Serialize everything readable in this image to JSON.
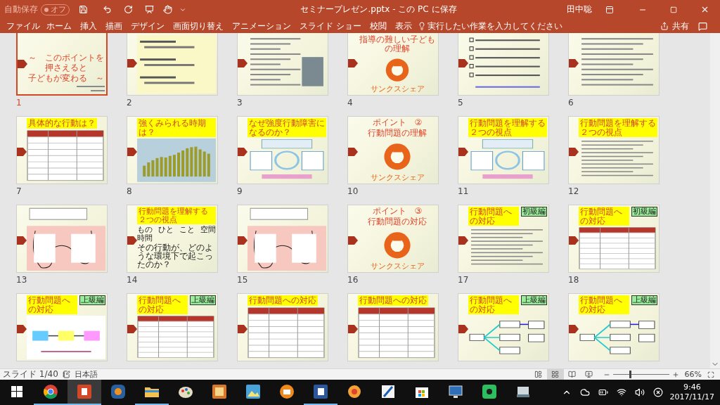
{
  "title_bar": {
    "autosave_label": "自動保存",
    "autosave_state": "オフ",
    "autosave_on": false,
    "document_title": "セミナープレゼン.pptx - この PC に保存",
    "user": "田中聡"
  },
  "ribbon": {
    "tabs": [
      {
        "label": "ファイル",
        "selected": false
      },
      {
        "label": "ホーム",
        "selected": false
      },
      {
        "label": "挿入",
        "selected": false
      },
      {
        "label": "描画",
        "selected": false
      },
      {
        "label": "デザイン",
        "selected": false
      },
      {
        "label": "画面切り替え",
        "selected": false
      },
      {
        "label": "アニメーション",
        "selected": false
      },
      {
        "label": "スライド ショー",
        "selected": false
      },
      {
        "label": "校閲",
        "selected": false
      },
      {
        "label": "表示",
        "selected": false
      }
    ],
    "tell_me": "実行したい作業を入力してください",
    "share": "共有"
  },
  "slides": [
    {
      "number": "1",
      "selected": true,
      "headings": [
        "～　このポイントを押さえると",
        "子どもが変わる　～"
      ],
      "kind": "byline"
    },
    {
      "number": "2",
      "selected": false,
      "kind": "bullets"
    },
    {
      "number": "3",
      "selected": false,
      "kind": "photo"
    },
    {
      "number": "4",
      "selected": false,
      "headings": [
        "指導の難しい子どもの理解"
      ],
      "kind": "logo",
      "logo": "サンクスシェア"
    },
    {
      "number": "5",
      "selected": false,
      "kind": "checklist"
    },
    {
      "number": "6",
      "selected": false,
      "kind": "text"
    },
    {
      "number": "7",
      "selected": false,
      "title": "具体的な行動は？",
      "kind": "table"
    },
    {
      "number": "8",
      "selected": false,
      "title": "強くみられる時期は？",
      "kind": "chart"
    },
    {
      "number": "9",
      "selected": false,
      "title": "なぜ強度行動障害になるのか？",
      "kind": "diagram"
    },
    {
      "number": "10",
      "selected": false,
      "headings": [
        "ポイント　②",
        "行動問題の理解"
      ],
      "kind": "logo",
      "logo": "サンクスシェア"
    },
    {
      "number": "11",
      "selected": false,
      "title": "行動問題を理解する２つの視点",
      "kind": "diagram"
    },
    {
      "number": "12",
      "selected": false,
      "title": "行動問題を理解する２つの視点",
      "kind": "text"
    },
    {
      "number": "13",
      "selected": false,
      "kind": "cloud"
    },
    {
      "number": "14",
      "selected": false,
      "title": "行動問題を理解する２つの視点",
      "words": [
        "もの",
        "ひと",
        "こと",
        "空間",
        "時間"
      ],
      "lines": [
        "その行動が、どのような環境下で起こったのか？"
      ],
      "kind": "plain"
    },
    {
      "number": "15",
      "selected": false,
      "kind": "cloud"
    },
    {
      "number": "16",
      "selected": false,
      "headings": [
        "ポイント　③",
        "行動問題の対応"
      ],
      "kind": "logo",
      "logo": "サンクスシェア"
    },
    {
      "number": "17",
      "selected": false,
      "title": "行動問題への対応",
      "badge": "初級編",
      "kind": "text"
    },
    {
      "number": "18",
      "selected": false,
      "title": "行動問題への対応",
      "badge": "初級編",
      "kind": "table"
    },
    {
      "selected": false,
      "title": "行動問題への対応",
      "badge": "上級編",
      "kind": "abc"
    },
    {
      "selected": false,
      "title": "行動問題への対応",
      "badge": "上級編",
      "kind": "table"
    },
    {
      "selected": false,
      "title": "行動問題への対応",
      "kind": "table"
    },
    {
      "selected": false,
      "title": "行動問題への対応",
      "kind": "table"
    },
    {
      "selected": false,
      "title": "行動問題への対応",
      "badge": "上級編",
      "kind": "flow"
    },
    {
      "selected": false,
      "title": "行動問題への対応",
      "badge": "上級編",
      "kind": "flow"
    }
  ],
  "status_bar": {
    "slide_count": "スライド 1/40",
    "language": "日本語",
    "views": [
      {
        "kind": "normal",
        "selected": false
      },
      {
        "kind": "sorter",
        "selected": true
      },
      {
        "kind": "reading",
        "selected": false
      },
      {
        "kind": "slideshow",
        "selected": false
      }
    ],
    "zoom": {
      "level": 0.3,
      "reading": "66%"
    }
  },
  "taskbar": {
    "apps": [
      {
        "kind": "chrome",
        "open": true,
        "selected": false
      },
      {
        "kind": "powerpoint",
        "open": true,
        "selected": true
      },
      {
        "kind": "media",
        "open": false,
        "selected": false
      },
      {
        "kind": "explorer",
        "open": true,
        "selected": false
      },
      {
        "kind": "paint",
        "open": false,
        "selected": false
      },
      {
        "kind": "photos",
        "open": false,
        "selected": false
      },
      {
        "kind": "gallery",
        "open": false,
        "selected": false
      },
      {
        "kind": "printer",
        "open": false,
        "selected": false
      },
      {
        "kind": "word",
        "open": true,
        "selected": false
      },
      {
        "kind": "flower",
        "open": false,
        "selected": false
      },
      {
        "kind": "pen",
        "open": false,
        "selected": false
      },
      {
        "kind": "store",
        "open": false,
        "selected": false
      },
      {
        "kind": "screen",
        "open": false,
        "selected": false
      },
      {
        "kind": "notes",
        "open": false,
        "selected": false
      },
      {
        "kind": "scanner",
        "open": false,
        "selected": false
      }
    ],
    "time": "9:46",
    "date": "2017/11/17"
  }
}
